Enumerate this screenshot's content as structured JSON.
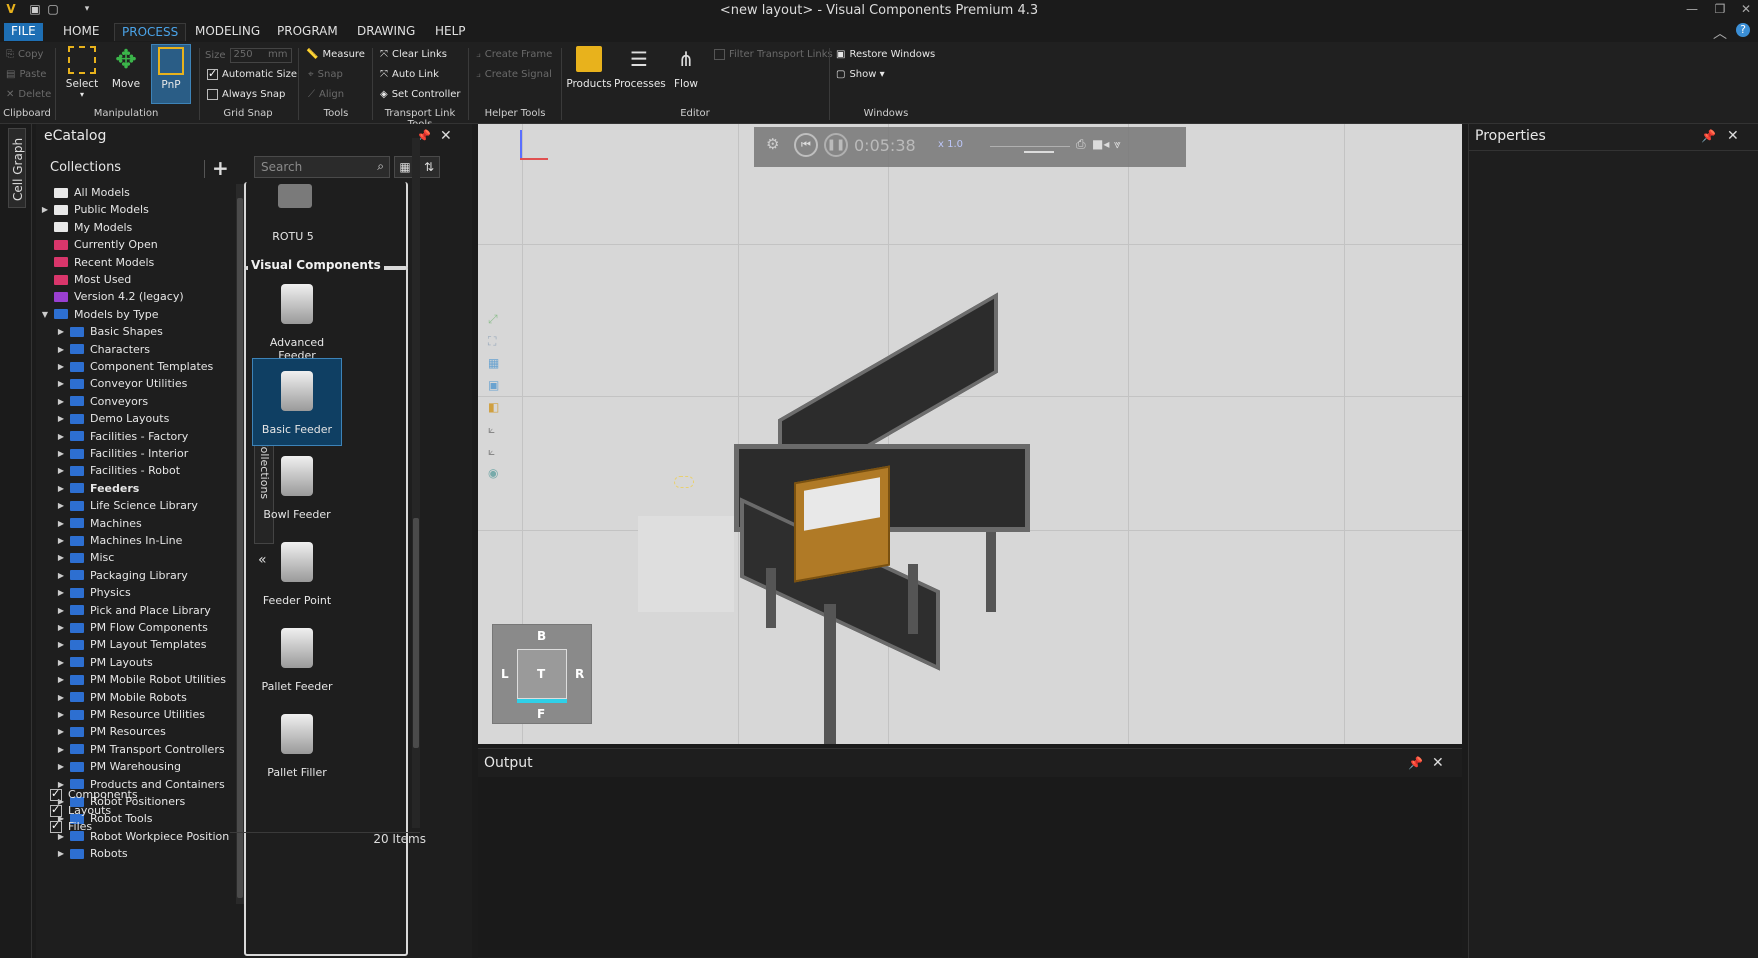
{
  "window": {
    "title": "<new layout> - Visual Components Premium 4.3"
  },
  "menu": {
    "file": "FILE",
    "home": "HOME",
    "process": "PROCESS",
    "modeling": "MODELING",
    "program": "PROGRAM",
    "drawing": "DRAWING",
    "help": "HELP"
  },
  "ribbon": {
    "clipboard": {
      "copy": "Copy",
      "paste": "Paste",
      "delete": "Delete",
      "group": "Clipboard"
    },
    "manipulation": {
      "select": "Select",
      "move": "Move",
      "pnp": "PnP",
      "group": "Manipulation"
    },
    "grid_snap": {
      "size_label": "Size",
      "size_value": "250",
      "size_unit": "mm",
      "automatic_size": "Automatic Size",
      "always_snap": "Always Snap",
      "group": "Grid Snap"
    },
    "tools": {
      "measure": "Measure",
      "snap": "Snap",
      "align": "Align",
      "group": "Tools"
    },
    "transport": {
      "clear_links": "Clear Links",
      "auto_link": "Auto Link",
      "set_controller": "Set Controller",
      "group": "Transport Link Tools"
    },
    "helper": {
      "create_frame": "Create Frame",
      "create_signal": "Create Signal",
      "group": "Helper Tools"
    },
    "editor": {
      "products": "Products",
      "processes": "Processes",
      "flow": "Flow",
      "filter_transport_links": "Filter Transport Links",
      "group": "Editor"
    },
    "windows": {
      "restore_windows": "Restore Windows",
      "show": "Show ▾",
      "group": "Windows"
    }
  },
  "left_strip": {
    "cell_graph": "Cell Graph"
  },
  "catalog": {
    "title": "eCatalog",
    "collections_label": "Collections",
    "search_placeholder": "Search",
    "collections_vtab": "Collections",
    "tree": [
      {
        "label": "All Models",
        "color": "#e8e8e8",
        "arrow": ""
      },
      {
        "label": "Public Models",
        "color": "#e8e8e8",
        "arrow": "▶"
      },
      {
        "label": "My Models",
        "color": "#e8e8e8",
        "arrow": ""
      },
      {
        "label": "Currently Open",
        "color": "#d9366b",
        "arrow": ""
      },
      {
        "label": "Recent Models",
        "color": "#d9366b",
        "arrow": ""
      },
      {
        "label": "Most Used",
        "color": "#d9366b",
        "arrow": ""
      },
      {
        "label": "Version 4.2 (legacy)",
        "color": "#9a3fd0",
        "arrow": ""
      },
      {
        "label": "Models by Type",
        "color": "#2d6fd1",
        "arrow": "▼"
      },
      {
        "label": "Basic Shapes",
        "color": "#2d6fd1",
        "arrow": "▶",
        "indent": true
      },
      {
        "label": "Characters",
        "color": "#2d6fd1",
        "arrow": "▶",
        "indent": true
      },
      {
        "label": "Component Templates",
        "color": "#2d6fd1",
        "arrow": "▶",
        "indent": true
      },
      {
        "label": "Conveyor Utilities",
        "color": "#2d6fd1",
        "arrow": "▶",
        "indent": true
      },
      {
        "label": "Conveyors",
        "color": "#2d6fd1",
        "arrow": "▶",
        "indent": true
      },
      {
        "label": "Demo Layouts",
        "color": "#2d6fd1",
        "arrow": "▶",
        "indent": true
      },
      {
        "label": "Facilities - Factory",
        "color": "#2d6fd1",
        "arrow": "▶",
        "indent": true
      },
      {
        "label": "Facilities - Interior",
        "color": "#2d6fd1",
        "arrow": "▶",
        "indent": true
      },
      {
        "label": "Facilities - Robot",
        "color": "#2d6fd1",
        "arrow": "▶",
        "indent": true
      },
      {
        "label": "Feeders",
        "color": "#2d6fd1",
        "arrow": "▶",
        "indent": true,
        "bold": true
      },
      {
        "label": "Life Science Library",
        "color": "#2d6fd1",
        "arrow": "▶",
        "indent": true
      },
      {
        "label": "Machines",
        "color": "#2d6fd1",
        "arrow": "▶",
        "indent": true
      },
      {
        "label": "Machines In-Line",
        "color": "#2d6fd1",
        "arrow": "▶",
        "indent": true
      },
      {
        "label": "Misc",
        "color": "#2d6fd1",
        "arrow": "▶",
        "indent": true
      },
      {
        "label": "Packaging Library",
        "color": "#2d6fd1",
        "arrow": "▶",
        "indent": true
      },
      {
        "label": "Physics",
        "color": "#2d6fd1",
        "arrow": "▶",
        "indent": true
      },
      {
        "label": "Pick and Place Library",
        "color": "#2d6fd1",
        "arrow": "▶",
        "indent": true
      },
      {
        "label": "PM Flow Components",
        "color": "#2d6fd1",
        "arrow": "▶",
        "indent": true
      },
      {
        "label": "PM Layout Templates",
        "color": "#2d6fd1",
        "arrow": "▶",
        "indent": true
      },
      {
        "label": "PM Layouts",
        "color": "#2d6fd1",
        "arrow": "▶",
        "indent": true
      },
      {
        "label": "PM Mobile Robot Utilities",
        "color": "#2d6fd1",
        "arrow": "▶",
        "indent": true
      },
      {
        "label": "PM Mobile Robots",
        "color": "#2d6fd1",
        "arrow": "▶",
        "indent": true
      },
      {
        "label": "PM Resource Utilities",
        "color": "#2d6fd1",
        "arrow": "▶",
        "indent": true
      },
      {
        "label": "PM Resources",
        "color": "#2d6fd1",
        "arrow": "▶",
        "indent": true
      },
      {
        "label": "PM Transport Controllers",
        "color": "#2d6fd1",
        "arrow": "▶",
        "indent": true
      },
      {
        "label": "PM Warehousing",
        "color": "#2d6fd1",
        "arrow": "▶",
        "indent": true
      },
      {
        "label": "Products and Containers",
        "color": "#2d6fd1",
        "arrow": "▶",
        "indent": true
      },
      {
        "label": "Robot Positioners",
        "color": "#2d6fd1",
        "arrow": "▶",
        "indent": true
      },
      {
        "label": "Robot Tools",
        "color": "#2d6fd1",
        "arrow": "▶",
        "indent": true
      },
      {
        "label": "Robot Workpiece Position",
        "color": "#2d6fd1",
        "arrow": "▶",
        "indent": true
      },
      {
        "label": "Robots",
        "color": "#2d6fd1",
        "arrow": "▶",
        "indent": true
      }
    ],
    "filters": [
      {
        "label": "Components",
        "checked": true
      },
      {
        "label": "Layouts",
        "checked": true
      },
      {
        "label": "Files",
        "checked": true
      }
    ],
    "prev_group_item": "ROTU 5",
    "group_title": "Visual Components",
    "items": [
      {
        "label": "Advanced Feeder",
        "icon": "advanced-feeder-icon"
      },
      {
        "label": "Basic Feeder",
        "icon": "basic-feeder-icon",
        "selected": true
      },
      {
        "label": "Bowl Feeder",
        "icon": "bowl-feeder-icon"
      },
      {
        "label": "Feeder Point",
        "icon": "feeder-point-icon"
      },
      {
        "label": "Pallet Feeder",
        "icon": "pallet-feeder-icon"
      },
      {
        "label": "Pallet Filler",
        "icon": "pallet-filler-icon"
      }
    ],
    "items_count": "20 Items"
  },
  "viewport": {
    "sim_time": "0:05:38",
    "sim_speed": "x 1.0",
    "navcube": {
      "top": "T",
      "back": "B",
      "left": "L",
      "right": "R",
      "front": "F"
    }
  },
  "output": {
    "title": "Output"
  },
  "properties": {
    "title": "Properties"
  },
  "colors": {
    "accent": "#1e6fb4",
    "selection": "#0f3f63",
    "viewport_bg": "#d7d7d7",
    "icon_yellow": "#e8b21c",
    "icon_green": "#3bb54a"
  }
}
